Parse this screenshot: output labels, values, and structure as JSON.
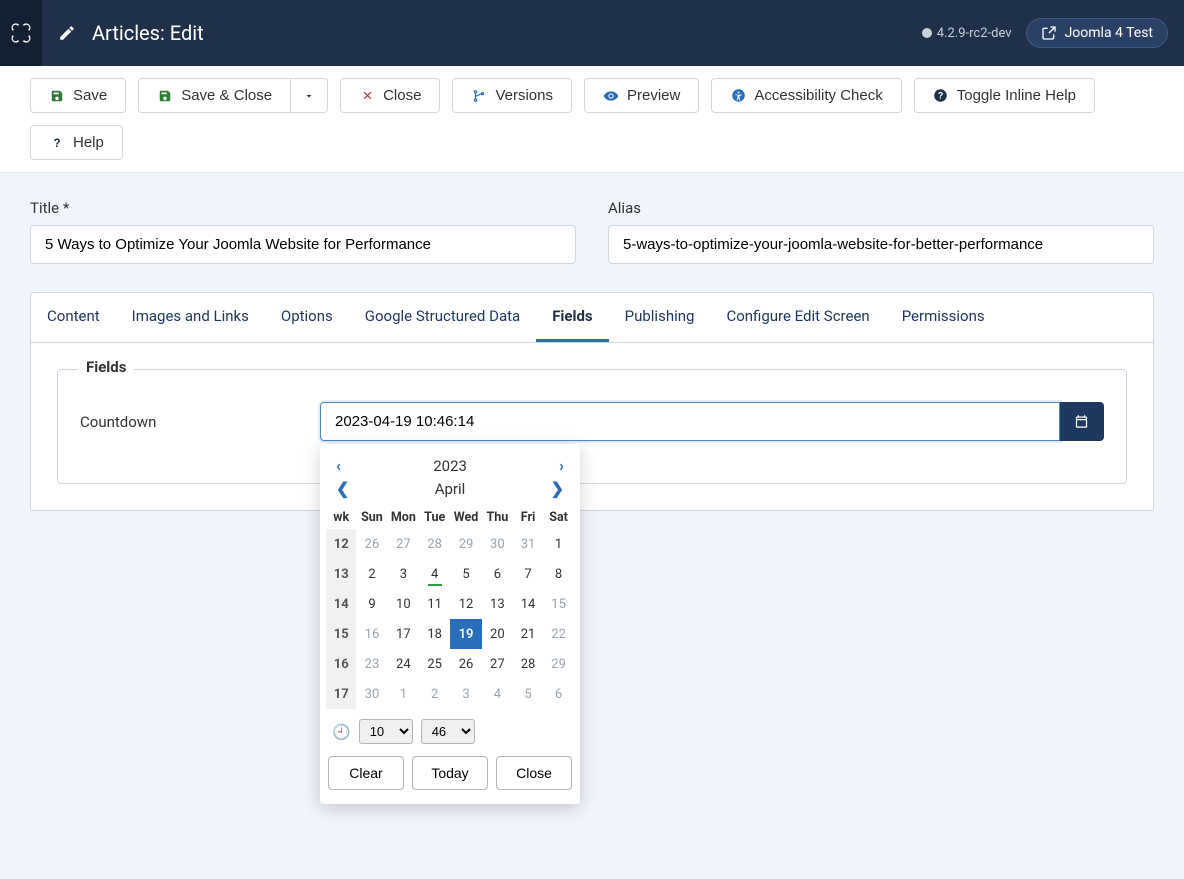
{
  "header": {
    "title": "Articles: Edit",
    "version": "4.2.9-rc2-dev",
    "site_name": "Joomla 4 Test"
  },
  "toolbar": {
    "save": "Save",
    "save_close": "Save & Close",
    "close": "Close",
    "versions": "Versions",
    "preview": "Preview",
    "accessibility": "Accessibility Check",
    "toggle_help": "Toggle Inline Help",
    "help": "Help"
  },
  "fields": {
    "title_label": "Title *",
    "title_value": "5 Ways to Optimize Your Joomla Website for Performance",
    "alias_label": "Alias",
    "alias_value": "5-ways-to-optimize-your-joomla-website-for-better-performance"
  },
  "tabs": {
    "content": "Content",
    "images": "Images and Links",
    "options": "Options",
    "gsd": "Google Structured Data",
    "fields": "Fields",
    "publishing": "Publishing",
    "config": "Configure Edit Screen",
    "permissions": "Permissions"
  },
  "panel": {
    "legend": "Fields",
    "countdown_label": "Countdown",
    "countdown_value": "2023-04-19 10:46:14"
  },
  "calendar": {
    "year": "2023",
    "month": "April",
    "weekdays": [
      "wk",
      "Sun",
      "Mon",
      "Tue",
      "Wed",
      "Thu",
      "Fri",
      "Sat"
    ],
    "weeks": [
      {
        "wk": "12",
        "days": [
          {
            "d": "26",
            "o": true
          },
          {
            "d": "27",
            "o": true
          },
          {
            "d": "28",
            "o": true
          },
          {
            "d": "29",
            "o": true
          },
          {
            "d": "30",
            "o": true
          },
          {
            "d": "31",
            "o": true
          },
          {
            "d": "1"
          }
        ]
      },
      {
        "wk": "13",
        "days": [
          {
            "d": "2"
          },
          {
            "d": "3"
          },
          {
            "d": "4",
            "today": true
          },
          {
            "d": "5"
          },
          {
            "d": "6"
          },
          {
            "d": "7"
          },
          {
            "d": "8"
          }
        ]
      },
      {
        "wk": "14",
        "days": [
          {
            "d": "9"
          },
          {
            "d": "10"
          },
          {
            "d": "11"
          },
          {
            "d": "12"
          },
          {
            "d": "13"
          },
          {
            "d": "14"
          },
          {
            "d": "15",
            "o": true
          }
        ]
      },
      {
        "wk": "15",
        "days": [
          {
            "d": "16",
            "o": true
          },
          {
            "d": "17"
          },
          {
            "d": "18"
          },
          {
            "d": "19",
            "sel": true
          },
          {
            "d": "20"
          },
          {
            "d": "21"
          },
          {
            "d": "22",
            "o": true
          }
        ]
      },
      {
        "wk": "16",
        "days": [
          {
            "d": "23",
            "o": true
          },
          {
            "d": "24"
          },
          {
            "d": "25"
          },
          {
            "d": "26"
          },
          {
            "d": "27"
          },
          {
            "d": "28"
          },
          {
            "d": "29",
            "o": true
          }
        ]
      },
      {
        "wk": "17",
        "days": [
          {
            "d": "30",
            "o": true
          },
          {
            "d": "1",
            "o": true
          },
          {
            "d": "2",
            "o": true
          },
          {
            "d": "3",
            "o": true
          },
          {
            "d": "4",
            "o": true
          },
          {
            "d": "5",
            "o": true
          },
          {
            "d": "6",
            "o": true
          }
        ]
      }
    ],
    "hour": "10",
    "minute": "46",
    "clear": "Clear",
    "today_btn": "Today",
    "close_btn": "Close"
  }
}
